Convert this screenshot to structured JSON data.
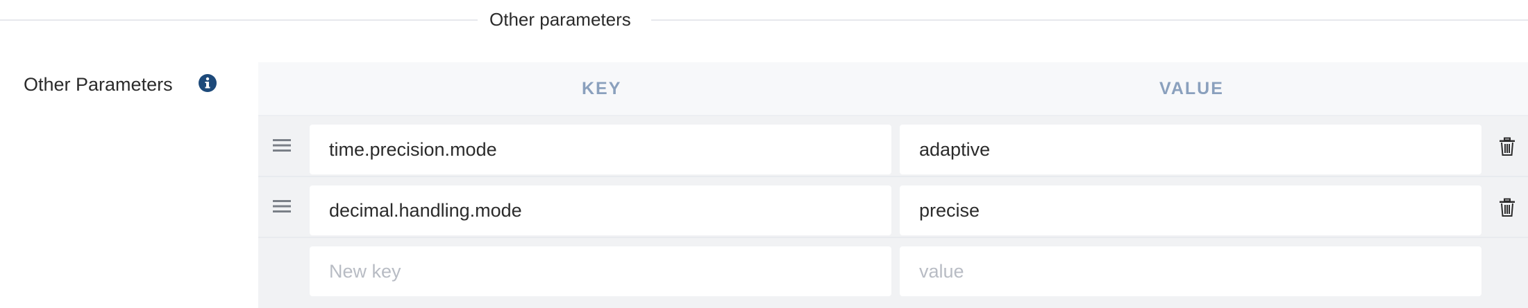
{
  "section": {
    "title": "Other parameters"
  },
  "field": {
    "label": "Other Parameters",
    "info_icon": "info-circle-icon"
  },
  "table": {
    "columns": {
      "key": "KEY",
      "value": "VALUE"
    },
    "rows": [
      {
        "key": "time.precision.mode",
        "value": "adaptive"
      },
      {
        "key": "decimal.handling.mode",
        "value": "precise"
      }
    ],
    "new_row": {
      "key_placeholder": "New key",
      "value_placeholder": "value"
    }
  },
  "icons": {
    "drag": "drag-handle-icon",
    "delete": "trash-icon"
  },
  "colors": {
    "header_text": "#8aa0bd",
    "info_icon": "#1d4a7a",
    "table_bg": "#f1f2f4"
  }
}
